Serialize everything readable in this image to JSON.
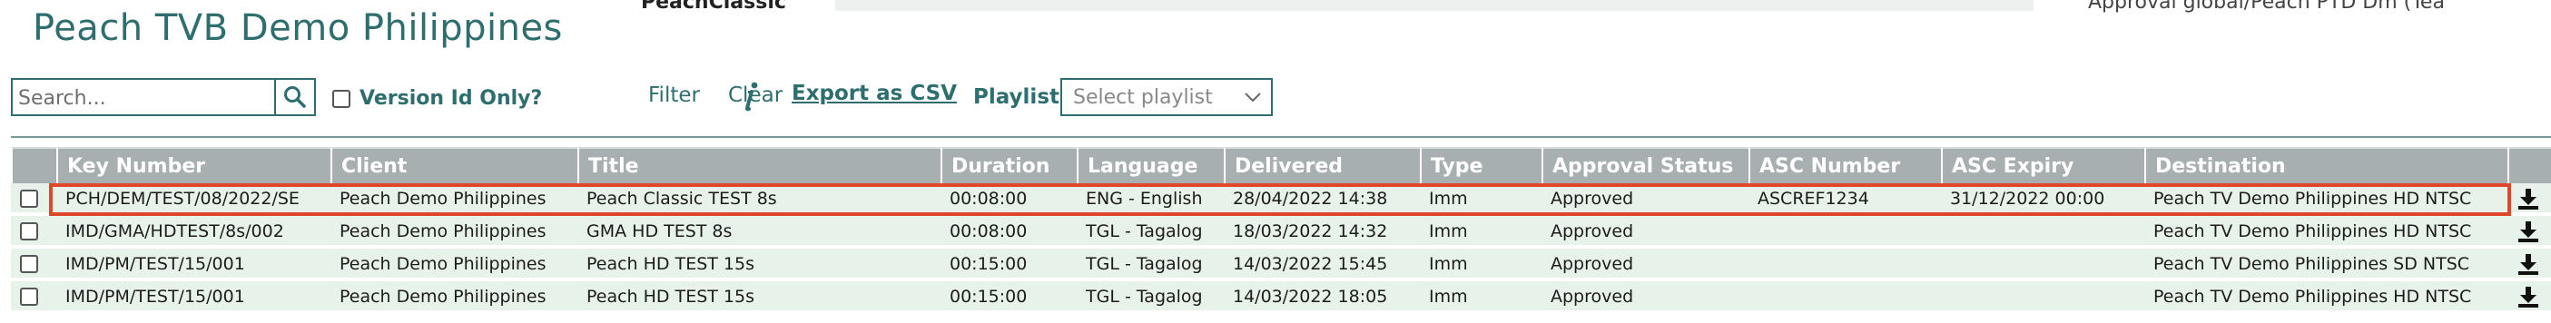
{
  "app": {
    "title": "Peach TVB Demo Philippines",
    "top_left_fragment": "PeachClassic",
    "top_right_fragment": "Approval global/Peach PTD Dm (Tea"
  },
  "toolbar": {
    "search_placeholder": "Search...",
    "search_icon": "search-icon",
    "version_only_label": "Version Id Only?",
    "filter_label": "Filter",
    "clear_label": "Clear",
    "info_icon": "info-icon",
    "export_label": "Export as CSV",
    "playlist_label": "Playlist",
    "playlist_placeholder": "Select playlist"
  },
  "table": {
    "columns": [
      "Key Number",
      "Client",
      "Title",
      "Duration",
      "Language",
      "Delivered",
      "Type",
      "Approval Status",
      "ASC Number",
      "ASC Expiry",
      "Destination"
    ],
    "rows": [
      {
        "key_number": "PCH/DEM/TEST/08/2022/SE",
        "client": "Peach Demo Philippines",
        "title": "Peach Classic TEST 8s",
        "duration": "00:08:00",
        "language": "ENG - English",
        "delivered": "28/04/2022 14:38",
        "type": "Imm",
        "approval_status": "Approved",
        "asc_number": "ASCREF1234",
        "asc_expiry": "31/12/2022 00:00",
        "destination": "Peach TV Demo Philippines HD NTSC",
        "highlighted": true
      },
      {
        "key_number": "IMD/GMA/HDTEST/8s/002",
        "client": "Peach Demo Philippines",
        "title": "GMA HD TEST 8s",
        "duration": "00:08:00",
        "language": "TGL - Tagalog",
        "delivered": "18/03/2022 14:32",
        "type": "Imm",
        "approval_status": "Approved",
        "asc_number": "",
        "asc_expiry": "",
        "destination": "Peach TV Demo Philippines HD NTSC",
        "highlighted": false
      },
      {
        "key_number": "IMD/PM/TEST/15/001",
        "client": "Peach Demo Philippines",
        "title": "Peach HD TEST 15s",
        "duration": "00:15:00",
        "language": "TGL - Tagalog",
        "delivered": "14/03/2022 15:45",
        "type": "Imm",
        "approval_status": "Approved",
        "asc_number": "",
        "asc_expiry": "",
        "destination": "Peach TV Demo Philippines SD NTSC",
        "highlighted": false
      },
      {
        "key_number": "IMD/PM/TEST/15/001",
        "client": "Peach Demo Philippines",
        "title": "Peach HD TEST 15s",
        "duration": "00:15:00",
        "language": "TGL - Tagalog",
        "delivered": "14/03/2022 18:05",
        "type": "Imm",
        "approval_status": "Approved",
        "asc_number": "",
        "asc_expiry": "",
        "destination": "Peach TV Demo Philippines HD NTSC",
        "highlighted": false
      }
    ],
    "download_icon": "download-icon"
  },
  "colors": {
    "brand": "#2e6e6e",
    "header_bg": "#a7afb0",
    "row_bg": "#e7f2ea",
    "highlight": "#e0462a"
  }
}
